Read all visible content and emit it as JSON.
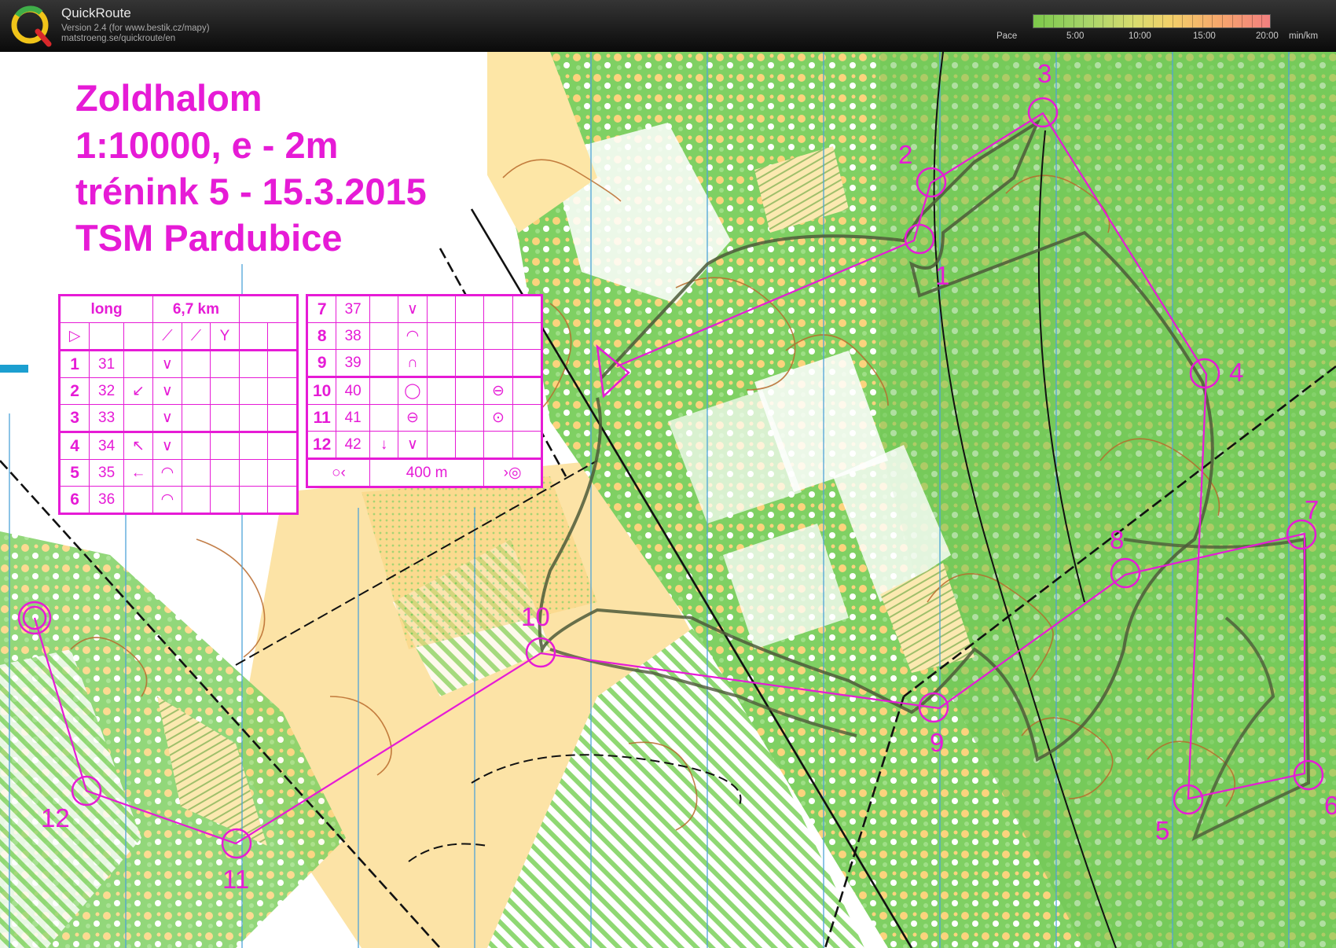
{
  "app": {
    "name": "QuickRoute",
    "version_line": "Version 2.4  (for www.bestik.cz/mapy)",
    "url_line": "matstroeng.se/quickroute/en"
  },
  "pace_legend": {
    "label": "Pace",
    "ticks": [
      "5:00",
      "10:00",
      "15:00",
      "20:00"
    ],
    "unit": "min/km"
  },
  "map_info": {
    "lines": [
      "Zoldhalom",
      "1:10000, e - 2m",
      "trénink 5 - 15.3.2015",
      "TSM Pardubice"
    ]
  },
  "course": {
    "name": "long",
    "length": "6,7 km",
    "finish_distance": "400 m",
    "controls": [
      {
        "num": "1",
        "code": "31",
        "dir": "",
        "feature": "∨"
      },
      {
        "num": "2",
        "code": "32",
        "dir": "↙",
        "feature": "∨"
      },
      {
        "num": "3",
        "code": "33",
        "dir": "",
        "feature": "∨"
      },
      {
        "num": "4",
        "code": "34",
        "dir": "↖",
        "feature": "∨"
      },
      {
        "num": "5",
        "code": "35",
        "dir": "←",
        "feature": "◠"
      },
      {
        "num": "6",
        "code": "36",
        "dir": "",
        "feature": "◠"
      },
      {
        "num": "7",
        "code": "37",
        "dir": "",
        "feature": "∨"
      },
      {
        "num": "8",
        "code": "38",
        "dir": "",
        "feature": "◠"
      },
      {
        "num": "9",
        "code": "39",
        "dir": "",
        "feature": "∩"
      },
      {
        "num": "10",
        "code": "40",
        "dir": "",
        "feature": "◯",
        "extra": "⊖"
      },
      {
        "num": "11",
        "code": "41",
        "dir": "",
        "feature": "⊖",
        "extra": "⊙"
      },
      {
        "num": "12",
        "code": "42",
        "dir": "↓",
        "feature": "∨"
      }
    ]
  },
  "control_labels": [
    "1",
    "2",
    "3",
    "4",
    "5",
    "6",
    "7",
    "8",
    "9",
    "10",
    "11",
    "12"
  ],
  "colors": {
    "course_magenta": "#e61bd6",
    "open_land": "#fbd37d",
    "forest_green": "#63c54a",
    "light_green": "#bde6a5",
    "contour_brown": "#b86a2c",
    "route_line": "#4e5a3a",
    "north_line": "#4fa3d8"
  }
}
